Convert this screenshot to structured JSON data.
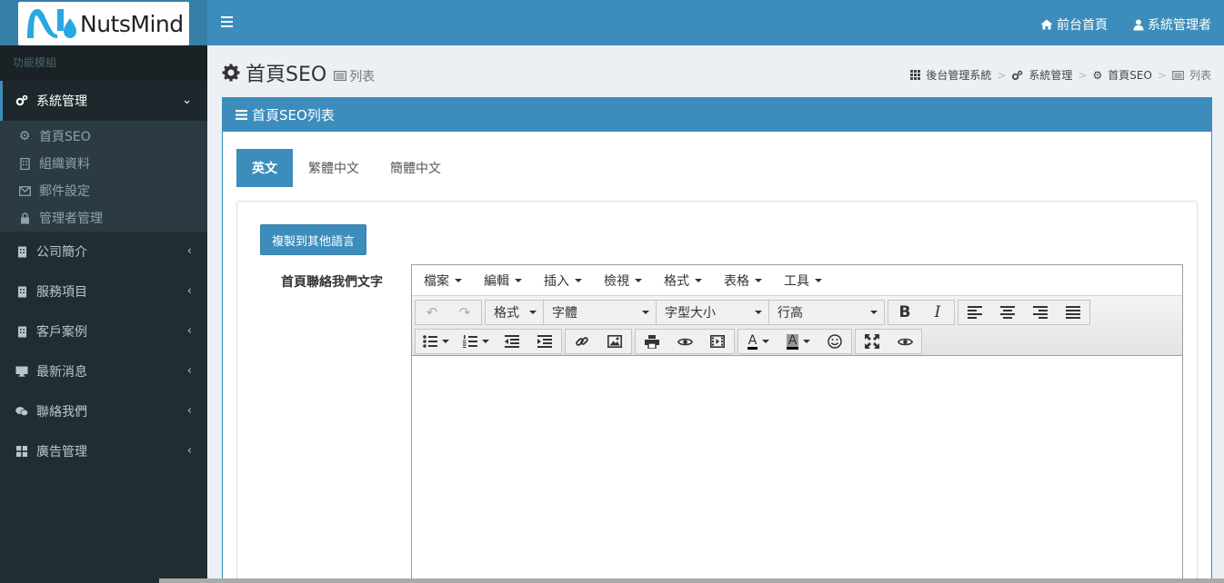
{
  "brand": {
    "name": "NutsMind"
  },
  "header": {
    "frontpage": "前台首頁",
    "user": "系統管理者"
  },
  "sidebar": {
    "section_title": "功能模組",
    "active": {
      "label": "系統管理"
    },
    "sub_items": [
      {
        "label": "首頁SEO",
        "icon": "gear-icon"
      },
      {
        "label": "組織資料",
        "icon": "building-icon"
      },
      {
        "label": "郵件設定",
        "icon": "envelope-icon"
      },
      {
        "label": "管理者管理",
        "icon": "lock-icon"
      }
    ],
    "items": [
      {
        "label": "公司簡介",
        "icon": "building-icon"
      },
      {
        "label": "服務項目",
        "icon": "building-icon"
      },
      {
        "label": "客戶案例",
        "icon": "building-icon"
      },
      {
        "label": "最新消息",
        "icon": "monitor-icon"
      },
      {
        "label": "聯絡我們",
        "icon": "chat-icon"
      },
      {
        "label": "廣告管理",
        "icon": "grid-icon"
      }
    ]
  },
  "page": {
    "title": "首頁SEO",
    "subtitle": "列表"
  },
  "breadcrumb": [
    "後台管理系統",
    "系統管理",
    "首頁SEO",
    "列表"
  ],
  "box": {
    "title": "首頁SEO列表"
  },
  "tabs": [
    "英文",
    "繁體中文",
    "簡體中文"
  ],
  "form": {
    "copy_button": "複製到其他語言",
    "field_label": "首頁聯絡我們文字"
  },
  "editor": {
    "menus": [
      "檔案",
      "編輯",
      "插入",
      "檢視",
      "格式",
      "表格",
      "工具"
    ],
    "format_label": "格式",
    "font_family_label": "字體",
    "font_size_label": "字型大小",
    "line_height_label": "行高",
    "text_color_label": "A",
    "bg_color_label": "A"
  }
}
